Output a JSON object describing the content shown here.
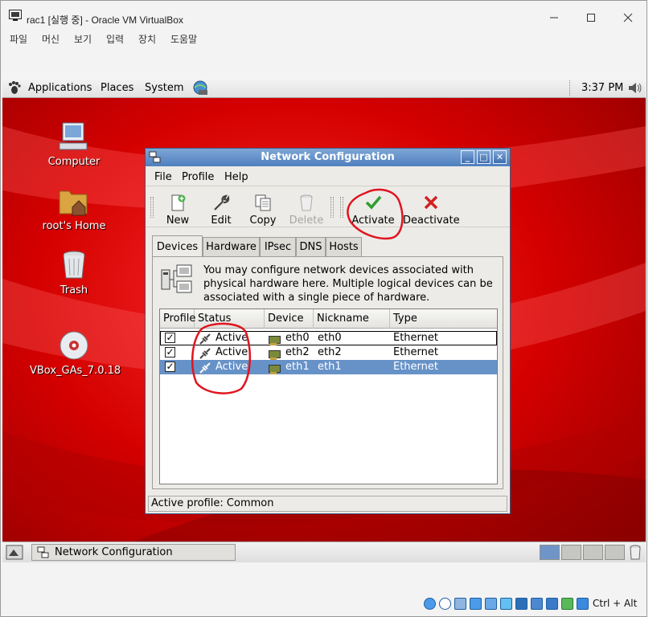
{
  "host": {
    "title": "rac1 [실행 중] - Oracle VM VirtualBox",
    "menu": [
      "파일",
      "머신",
      "보기",
      "입력",
      "장치",
      "도움말"
    ],
    "status_hostkey": "Ctrl + Alt"
  },
  "guest_panel": {
    "menus": [
      "Applications",
      "Places",
      "System"
    ],
    "clock": "3:37 PM"
  },
  "desktop_icons": [
    {
      "label": "Computer",
      "icon": "computer-icon"
    },
    {
      "label": "root's Home",
      "icon": "home-folder-icon"
    },
    {
      "label": "Trash",
      "icon": "trash-icon"
    },
    {
      "label": "VBox_GAs_7.0.18",
      "icon": "cdrom-icon"
    }
  ],
  "netconf": {
    "title": "Network Configuration",
    "menu": [
      "File",
      "Profile",
      "Help"
    ],
    "toolbar": {
      "new": "New",
      "edit": "Edit",
      "copy": "Copy",
      "delete": "Delete",
      "activate": "Activate",
      "deactivate": "Deactivate"
    },
    "tabs": [
      "Devices",
      "Hardware",
      "IPsec",
      "DNS",
      "Hosts"
    ],
    "active_tab": "Devices",
    "hint": "You may configure network devices associated with physical hardware here.  Multiple logical devices can be associated with a single piece of hardware.",
    "columns": [
      "Profile",
      "Status",
      "Device",
      "Nickname",
      "Type"
    ],
    "rows": [
      {
        "profile": true,
        "status": "Active",
        "device": "eth0",
        "nickname": "eth0",
        "type": "Ethernet"
      },
      {
        "profile": true,
        "status": "Active",
        "device": "eth2",
        "nickname": "eth2",
        "type": "Ethernet"
      },
      {
        "profile": true,
        "status": "Active",
        "device": "eth1",
        "nickname": "eth1",
        "type": "Ethernet"
      }
    ],
    "selected_row": 2,
    "status": "Active profile: Common"
  },
  "taskbar": {
    "task": "Network Configuration"
  },
  "colors": {
    "desktop_red": "#c80000",
    "titlebar_blue": "#4f7fbf",
    "selection_blue": "#6792c8",
    "annotation_red": "#e0141e"
  }
}
